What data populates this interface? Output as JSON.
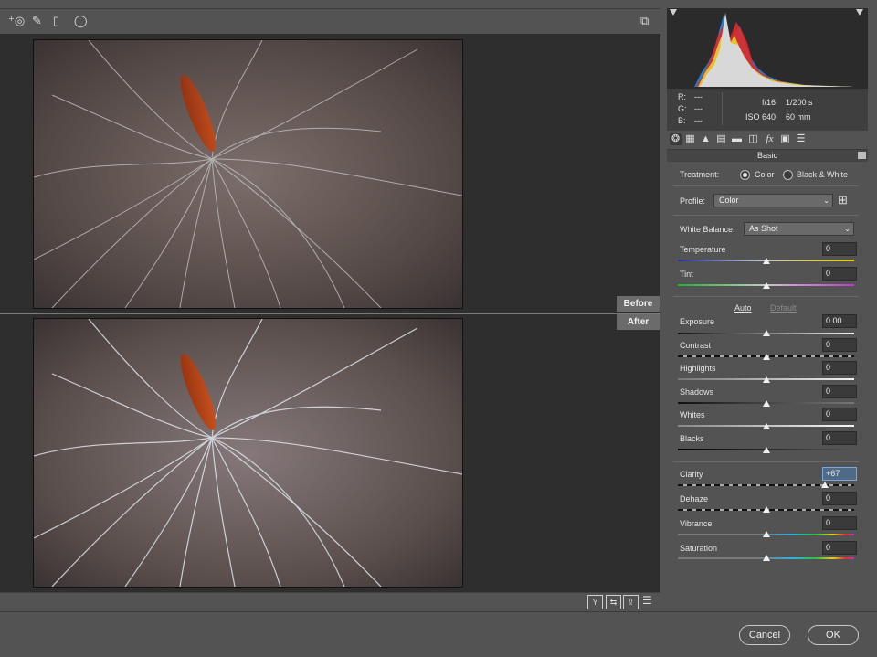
{
  "toolbar": {
    "tools": [
      "redeye-tool-icon",
      "adjustment-brush-icon",
      "graduated-filter-icon",
      "radial-filter-icon"
    ],
    "right_icon": "open-preferences-icon"
  },
  "preview": {
    "before_label": "Before",
    "after_label": "After",
    "footer_icons": [
      "before-after-toggle-icon",
      "swap-before-after-icon",
      "copy-settings-icon",
      "preview-preferences-icon"
    ]
  },
  "info": {
    "r_label": "R:",
    "r_value": "---",
    "g_label": "G:",
    "g_value": "---",
    "b_label": "B:",
    "b_value": "---",
    "aperture": "f/16",
    "shutter": "1/200 s",
    "iso": "ISO 640",
    "focal": "60 mm"
  },
  "tabs": {
    "icons": [
      "basic-tab-icon",
      "tone-curve-tab-icon",
      "detail-tab-icon",
      "hsl-tab-icon",
      "split-toning-tab-icon",
      "lens-corrections-tab-icon",
      "effects-tab-icon",
      "camera-calibration-tab-icon",
      "presets-tab-icon"
    ],
    "active_title": "Basic"
  },
  "basic": {
    "treatment_label": "Treatment:",
    "treatment_color": "Color",
    "treatment_bw": "Black & White",
    "profile_label": "Profile:",
    "profile_value": "Color",
    "wb_label": "White Balance:",
    "wb_value": "As Shot",
    "auto_label": "Auto",
    "default_label": "Default",
    "sliders": {
      "temperature": {
        "label": "Temperature",
        "value": "0",
        "position": 0.5
      },
      "tint": {
        "label": "Tint",
        "value": "0",
        "position": 0.5
      },
      "exposure": {
        "label": "Exposure",
        "value": "0.00",
        "position": 0.5
      },
      "contrast": {
        "label": "Contrast",
        "value": "0",
        "position": 0.5
      },
      "highlights": {
        "label": "Highlights",
        "value": "0",
        "position": 0.5
      },
      "shadows": {
        "label": "Shadows",
        "value": "0",
        "position": 0.5
      },
      "whites": {
        "label": "Whites",
        "value": "0",
        "position": 0.5
      },
      "blacks": {
        "label": "Blacks",
        "value": "0",
        "position": 0.5
      },
      "clarity": {
        "label": "Clarity",
        "value": "+67",
        "position": 0.835
      },
      "dehaze": {
        "label": "Dehaze",
        "value": "0",
        "position": 0.5
      },
      "vibrance": {
        "label": "Vibrance",
        "value": "0",
        "position": 0.5
      },
      "saturation": {
        "label": "Saturation",
        "value": "0",
        "position": 0.5
      }
    }
  },
  "footer": {
    "cancel_label": "Cancel",
    "ok_label": "OK"
  },
  "colors": {
    "accent": "#4e6a86",
    "panel_bg": "#535353",
    "preview_bg": "#2e2e2e"
  }
}
